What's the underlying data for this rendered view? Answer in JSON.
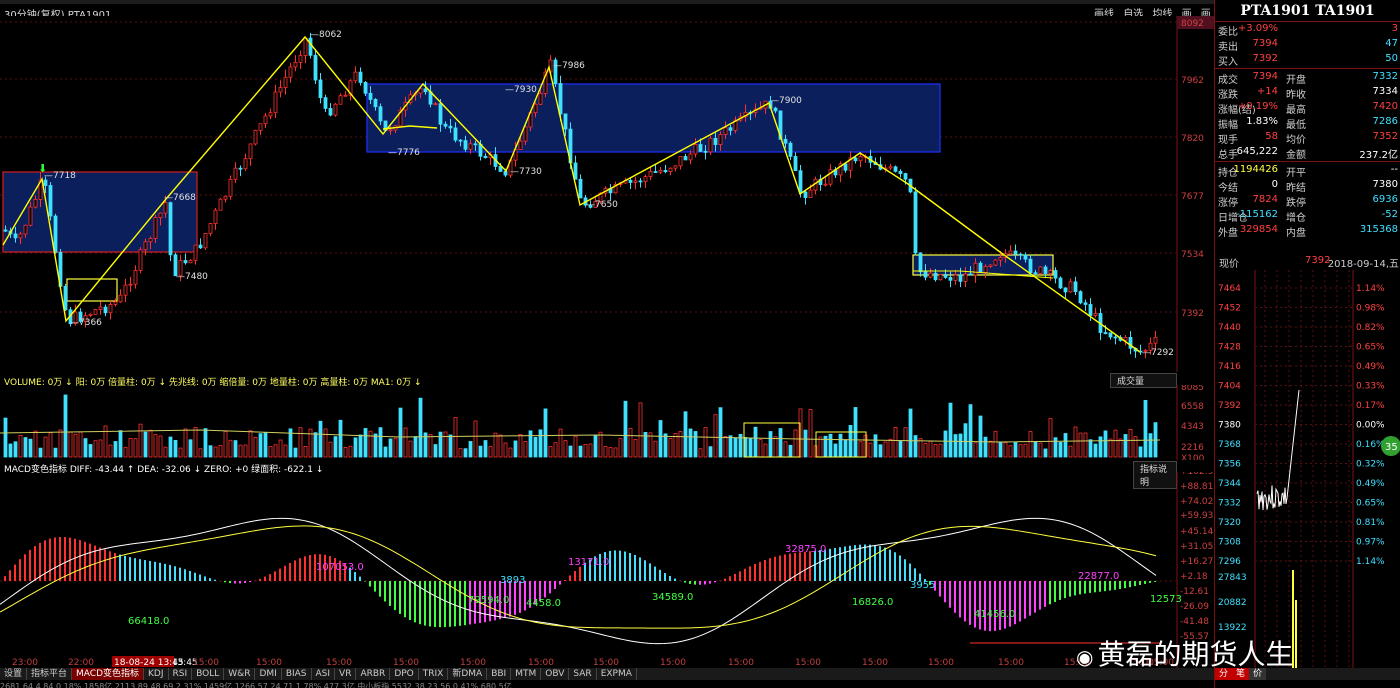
{
  "window": {
    "title": "30分钟(复权)   PTA1901"
  },
  "toolbar": {
    "items": [
      "画线",
      "自选",
      "均线",
      "画",
      "画"
    ]
  },
  "price_axis": {
    "labels": [
      "8092",
      "7962",
      "7820",
      "7677",
      "7534",
      "7392"
    ]
  },
  "main_chart": {
    "boxes": [],
    "annotations": [
      "7718",
      "7366",
      "7668",
      "7480",
      "8062",
      "7776",
      "7930",
      "7986",
      "7730",
      "7650",
      "7900",
      "7292"
    ]
  },
  "volume": {
    "header": "VOLUME: 0万 ↓  阳: 0万  倍量柱: 0万 ↓  先兆线: 0万  缩倍量: 0万  地量柱: 0万  高量柱: 0万  MA1: 0万 ↓",
    "button": "成交量",
    "axis": [
      "8085",
      "6558",
      "4343",
      "2216",
      "X100"
    ]
  },
  "macd": {
    "header": "MACD变色指标  DIFF: -43.44 ↑  DEA: -32.06 ↓  ZERO: +0  绿面积: -622.1 ↓",
    "button": "指标说明",
    "axis": [
      "+102.9",
      "+88.81",
      "+74.02",
      "+59.93",
      "+45.14",
      "+31.05",
      "+16.27",
      "+2.18",
      "-12.61",
      "-26.09",
      "-41.48",
      "-55.57"
    ],
    "labels": [
      "107053.0",
      "13171.0",
      "32875.0",
      "66418.0",
      "79594.0",
      "4458.0",
      "34589.0",
      "16826.0",
      "41456.0",
      "22877.0",
      "3893",
      "12573",
      "3955"
    ]
  },
  "time_axis": [
    "23:00",
    "22:00",
    "18-08-24 13:45",
    "15:00",
    "15:00",
    "15:00",
    "15:00",
    "15:00",
    "15:00",
    "15:00",
    "15:00",
    "15:00",
    "15:00",
    "15:00",
    "15:00",
    "15:00",
    "15:00",
    "15:00",
    "15:00"
  ],
  "tabs": [
    "设置",
    "指标平台",
    "MACD变色指标",
    "KDJ",
    "RSI",
    "BOLL",
    "W&R",
    "DMI",
    "BIAS",
    "ASI",
    "VR",
    "ARBR",
    "DPO",
    "TRIX",
    "新DMA",
    "BBI",
    "MTM",
    "OBV",
    "SAR",
    "EXPMA"
  ],
  "statusbar": "2681.64   4.84   0.18%   1858亿   2113.89   48.69   2.31%   1459亿   1266.57   24.71   1.78%   477.3亿   中小板指   5532.38   23.56   0.41%   680.5亿",
  "panel": {
    "title": "PTA1901 TA1901",
    "rows": [
      {
        "l": "委比",
        "v": "+3.09%",
        "vc": "#ff4040",
        "l2": "",
        "v2": "3",
        "v2c": "#ff4040"
      },
      {
        "l": "卖出",
        "v": "7394",
        "vc": "#ff4040",
        "l2": "",
        "v2": "47",
        "v2c": "#40e0ff"
      },
      {
        "l": "买入",
        "v": "7392",
        "vc": "#ff4040",
        "l2": "",
        "v2": "50",
        "v2c": "#40e0ff"
      },
      {
        "sep": true
      },
      {
        "l": "成交",
        "v": "7394",
        "vc": "#ff4040",
        "l2": "开盘",
        "v2": "7332",
        "v2c": "#40e0ff"
      },
      {
        "l": "涨跌",
        "v": "+14",
        "vc": "#ff4040",
        "l2": "昨收",
        "v2": "7334",
        "v2c": "#ffffff"
      },
      {
        "l": "涨幅(结)",
        "v": "+0.19%",
        "vc": "#ff4040",
        "l2": "最高",
        "v2": "7420",
        "v2c": "#ff4040"
      },
      {
        "l": "振幅",
        "v": "1.83%",
        "vc": "#ffffff",
        "l2": "最低",
        "v2": "7286",
        "v2c": "#40e0ff"
      },
      {
        "l": "现手",
        "v": "58",
        "vc": "#ff4040",
        "l2": "均价",
        "v2": "7352",
        "v2c": "#ff4040"
      },
      {
        "l": "总手",
        "v": "645,222",
        "vc": "#ffffff",
        "l2": "金额",
        "v2": "237.2亿",
        "v2c": "#ffffff"
      },
      {
        "sep": true
      },
      {
        "l": "持仓",
        "v": "1194426",
        "vc": "#ffff40",
        "l2": "开平",
        "v2": "--",
        "v2c": "#ffffff"
      },
      {
        "l": "今结",
        "v": "0",
        "vc": "#ffffff",
        "l2": "昨结",
        "v2": "7380",
        "v2c": "#ffffff"
      },
      {
        "l": "涨停",
        "v": "7824",
        "vc": "#ff4040",
        "l2": "跌停",
        "v2": "6936",
        "v2c": "#40e0ff"
      },
      {
        "l": "日增仓",
        "v": "-115162",
        "vc": "#40e0ff",
        "l2": "增仓",
        "v2": "-52",
        "v2c": "#40e0ff"
      },
      {
        "l": "外盘",
        "v": "329854",
        "vc": "#ff4040",
        "l2": "内盘",
        "v2": "315368",
        "v2c": "#40e0ff"
      }
    ],
    "xianjia": {
      "label": "现价",
      "value": "7392",
      "date": "2018-09-14,五"
    },
    "mini_left": [
      "7464",
      "7452",
      "7440",
      "7428",
      "7416",
      "7404",
      "7392",
      "7380",
      "7368",
      "7356",
      "7344",
      "7332",
      "7320",
      "7308",
      "7296",
      "27843",
      "20882",
      "13922"
    ],
    "mini_right": [
      "1.14%",
      "0.98%",
      "0.82%",
      "0.65%",
      "0.49%",
      "0.33%",
      "0.17%",
      "0.00%",
      "0.16%",
      "0.32%",
      "0.49%",
      "0.65%",
      "0.81%",
      "0.97%",
      "1.14%"
    ],
    "badge": "35",
    "bottom_tabs": [
      "分",
      "笔",
      "价"
    ]
  },
  "logo": {
    "text": "黄磊的期货人生"
  },
  "colors": {
    "up": "#ff3030",
    "down": "#40e0ff",
    "box_fill": "#0b1f5c",
    "box_edge": "#2030ff",
    "line": "#ffff00"
  }
}
